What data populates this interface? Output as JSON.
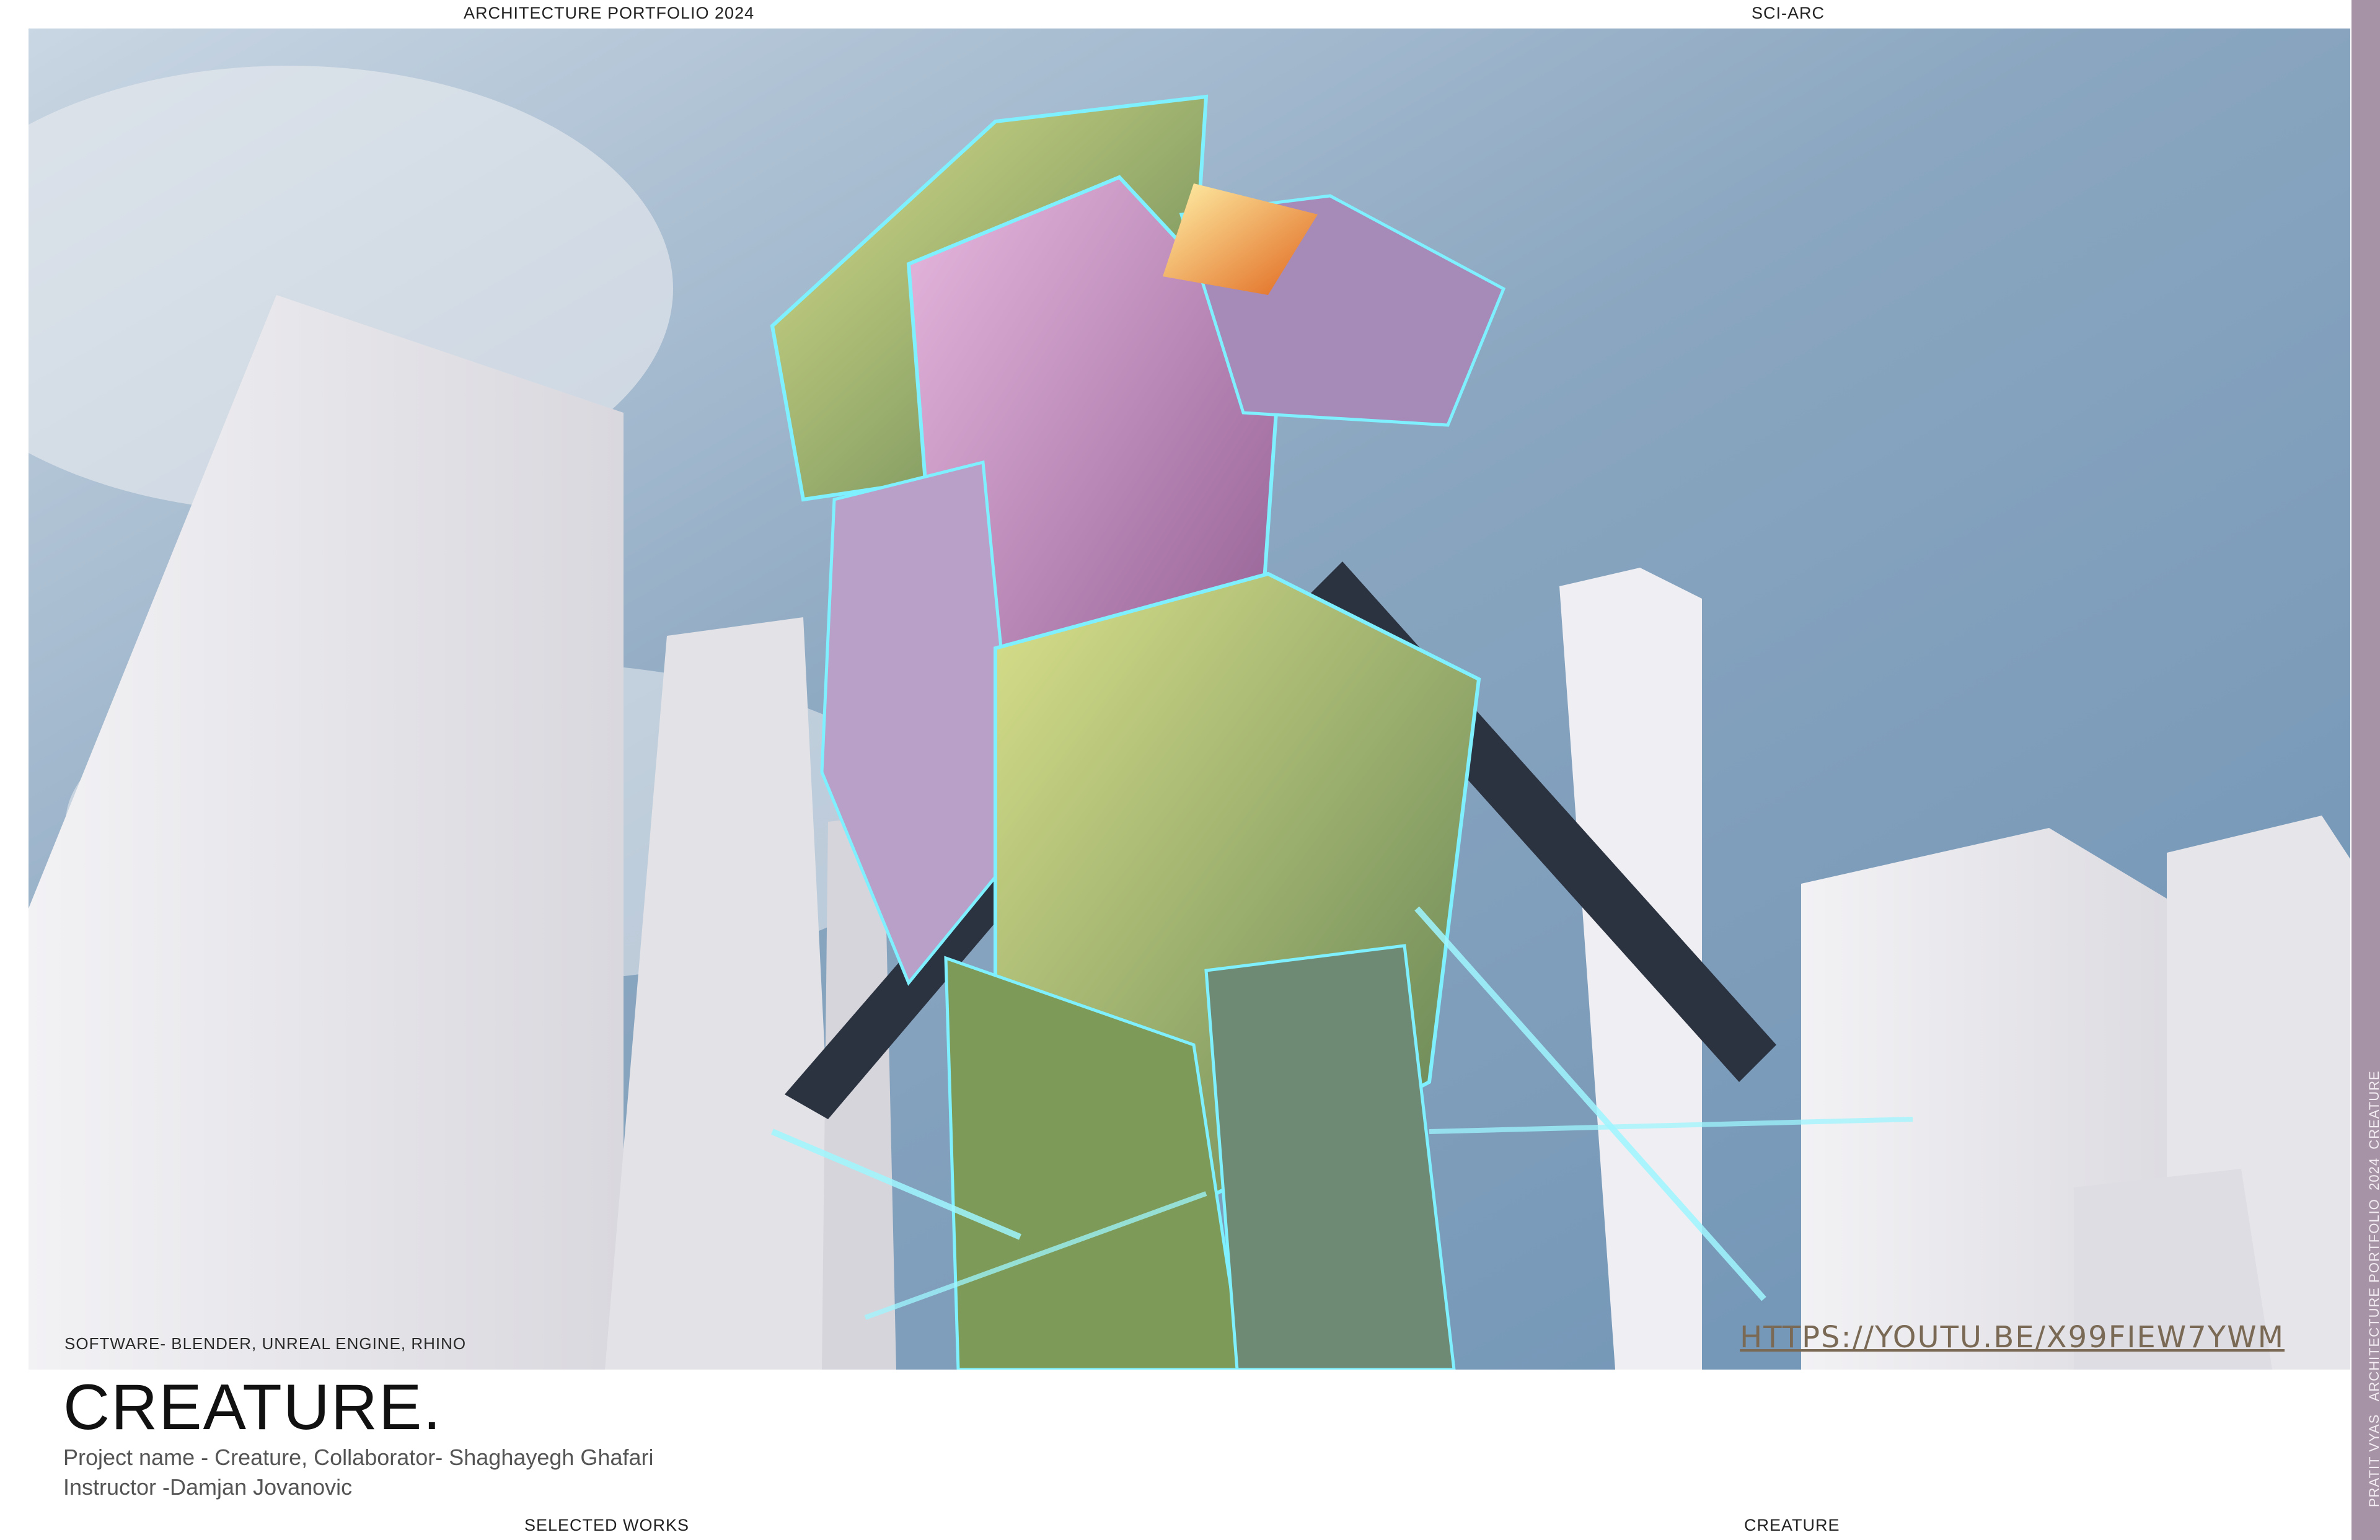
{
  "header": {
    "left": "ARCHITECTURE PORTFOLIO 2024",
    "right": "SCI-ARC"
  },
  "hero": {
    "alt": "render of a crystalline creature structure among white towers",
    "software": "SOFTWARE- BLENDER, UNREAL ENGINE, RHINO",
    "url": "HTTPS://YOUTU.BE/X99FIEW7YWM"
  },
  "sidebar": {
    "text": "PRATIT VYAS _ARCHITECTURE PORTFOLIO_2024_CREATURE",
    "color": "#a793a6"
  },
  "content": {
    "title": "CREATURE.",
    "project_line": "Project name - Creature, Collaborator- Shaghayegh Ghafari",
    "instructor_line": "Instructor -Damjan Jovanovic"
  },
  "footer": {
    "left": "SELECTED WORKS",
    "right": "CREATURE"
  },
  "colors": {
    "sky": "#8fa9bf",
    "building": "#ecebee",
    "accent_glow": "#7ff0ff",
    "crystal_pink": "#c88fbf",
    "crystal_green": "#9fb56a"
  }
}
